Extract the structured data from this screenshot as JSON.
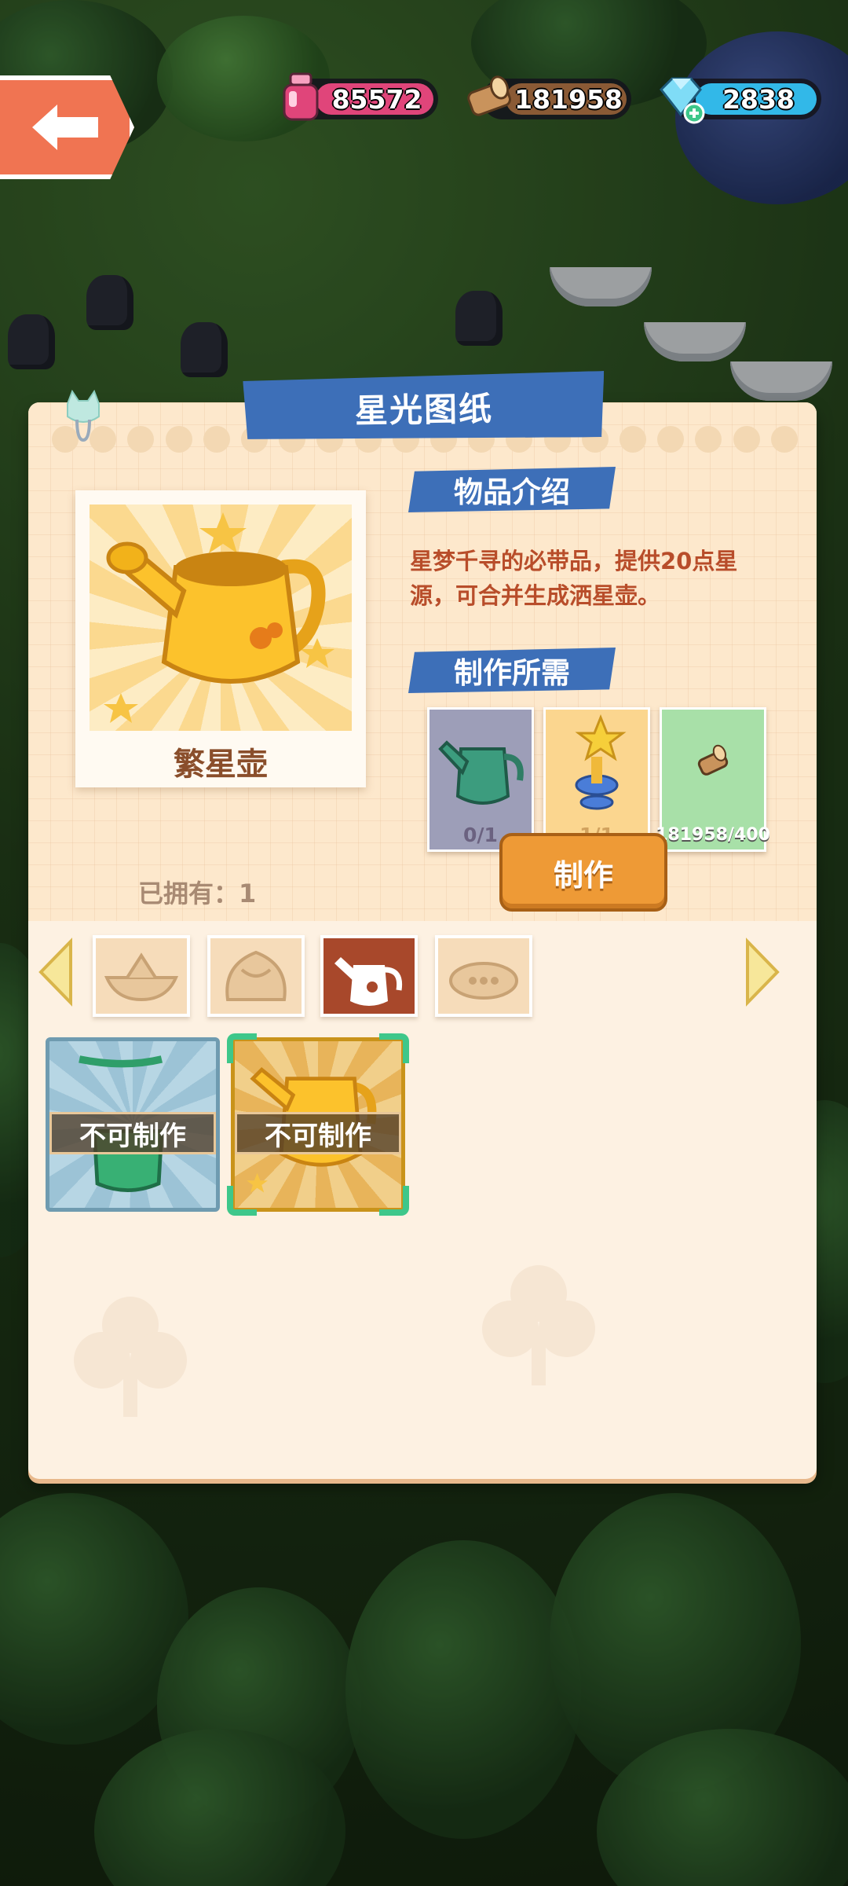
{
  "resources": [
    {
      "name": "ink",
      "value": "85572",
      "color": "#e0457a",
      "icon": "ink-bottle-icon"
    },
    {
      "name": "wood",
      "value": "181958",
      "color": "#8a5a35",
      "icon": "wood-log-icon"
    },
    {
      "name": "gem",
      "value": "2838",
      "color": "#32b8e8",
      "icon": "diamond-plus-icon"
    }
  ],
  "panel": {
    "title": "星光图纸",
    "item_name": "繁星壶",
    "desc_title": "物品介绍",
    "description": "星梦千寻的必带品，提供20点星源，可合并生成洒星壶。",
    "req_title": "制作所需",
    "requirements": [
      {
        "name": "green watering can",
        "count": "0/1"
      },
      {
        "name": "star trophy",
        "count": "1/1"
      },
      {
        "name": "wood",
        "count": "181958/400"
      }
    ],
    "make_label": "制作",
    "owned_text": "已拥有：1"
  },
  "tabs": [
    {
      "icon": "boat-icon",
      "active": false
    },
    {
      "icon": "rock-icon",
      "active": false
    },
    {
      "icon": "watering-can-icon",
      "active": true
    },
    {
      "icon": "cloud-icon",
      "active": false
    }
  ],
  "slots": [
    {
      "label": "不可制作",
      "item": "green-watering-can",
      "selected": false
    },
    {
      "label": "不可制作",
      "item": "golden-watering-can",
      "selected": true
    }
  ],
  "colors": {
    "accent_blue": "#3d6fb8",
    "button_orange": "#ee9a36",
    "panel_bg": "#fdf1e2"
  }
}
